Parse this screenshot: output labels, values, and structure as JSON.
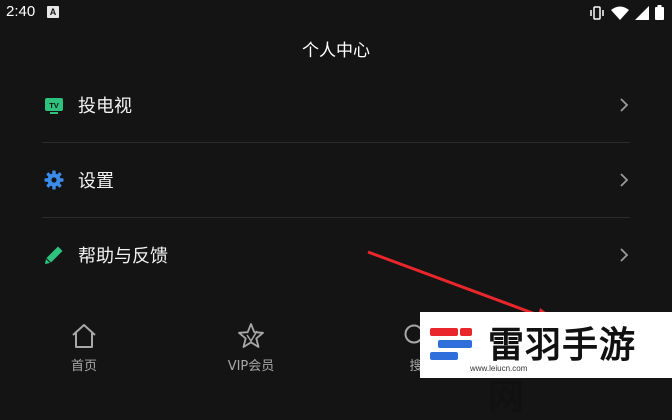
{
  "status_bar": {
    "time": "2:40",
    "notification_glyph": "A"
  },
  "header": {
    "title": "个人中心"
  },
  "menu": {
    "items": [
      {
        "label": "投电视",
        "icon": "tv-icon",
        "icon_text": "TV"
      },
      {
        "label": "设置",
        "icon": "gear-icon"
      },
      {
        "label": "帮助与反馈",
        "icon": "pencil-icon"
      }
    ]
  },
  "tabs": [
    {
      "label": "首页",
      "icon": "home-icon"
    },
    {
      "label": "VIP会员",
      "icon": "star-icon"
    },
    {
      "label": "搜",
      "icon": "search-icon"
    }
  ],
  "watermark": {
    "text": "雷羽手游网",
    "url": "www.leiucn.com"
  },
  "colors": {
    "background": "#141414",
    "accent_green": "#2ec27e",
    "accent_blue": "#3b8beb",
    "arrow_red": "#e8262c",
    "divider": "#2c2c2c"
  }
}
